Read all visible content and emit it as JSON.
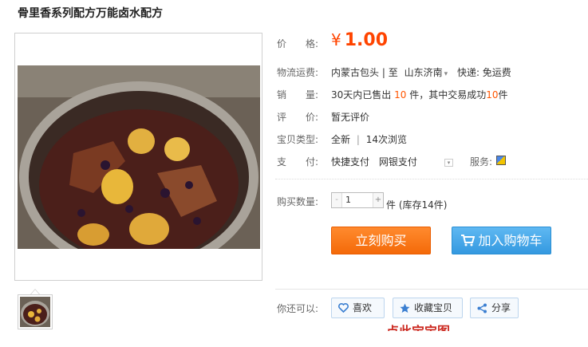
{
  "product": {
    "title": "骨里香系列配方万能卤水配方"
  },
  "price": {
    "label": "价　　格:",
    "currency": "¥",
    "value": "1.00"
  },
  "shipping": {
    "label": "物流运费:",
    "origin": "内蒙古包头",
    "separator": "|",
    "to_prefix": "至",
    "destination": "山东济南",
    "express": "快递: 免运费"
  },
  "sales": {
    "label": "销　　量:",
    "text_a": "30天内已售出",
    "sold": "10",
    "text_b": "件，其中交易成功",
    "success": "10",
    "text_c": "件"
  },
  "review": {
    "label": "评　　价:",
    "value": "暂无评价"
  },
  "item_type": {
    "label": "宝贝类型:",
    "condition": "全新",
    "separator": "|",
    "views": "14次浏览"
  },
  "payment": {
    "label": "支　　付:",
    "method_1": "快捷支付",
    "method_2": "网银支付",
    "service_label": "服务:"
  },
  "purchase": {
    "label": "购买数量:",
    "minus": "-",
    "quantity": "1",
    "plus": "+",
    "unit": "件",
    "stock": "(库存14件)"
  },
  "buttons": {
    "buy_now": "立刻购买",
    "add_to_cart": "加入购物车"
  },
  "more": {
    "label": "你还可以:",
    "like": "喜欢",
    "favorite": "收藏宝贝",
    "share": "分享"
  },
  "cut_text": "点此宝宝图",
  "colors": {
    "price": "#ff4400",
    "buy_button": "#f46a09",
    "cart_button": "#3499e0",
    "highlight": "#ff5500"
  },
  "icons": {
    "dropdown": "chevron-down-icon",
    "service": "service-badge-icon",
    "cart": "cart-icon",
    "heart": "heart-icon",
    "star": "star-icon",
    "share": "share-icon"
  }
}
